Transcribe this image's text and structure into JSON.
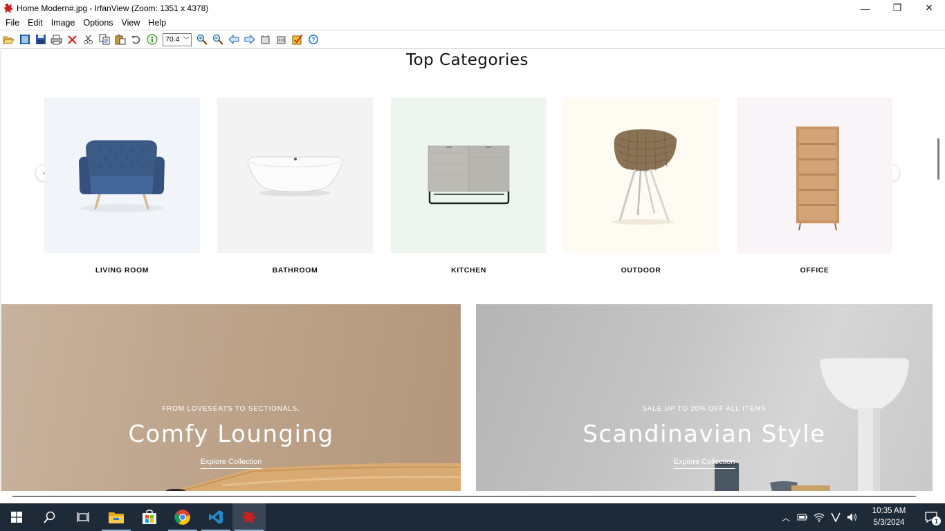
{
  "window": {
    "title": "Home Modern#.jpg - IrfanView (Zoom: 1351 x 4378)",
    "minimize_glyph": "—",
    "maximize_glyph": "❐",
    "close_glyph": "✕"
  },
  "menu": [
    "File",
    "Edit",
    "Image",
    "Options",
    "View",
    "Help"
  ],
  "toolbar": {
    "zoom_value": "70.4",
    "icons": [
      "open-icon",
      "thumbnails-icon",
      "save-icon",
      "print-icon",
      "delete-icon",
      "cut-icon",
      "copy-icon",
      "paste-icon",
      "undo-icon",
      "info-icon",
      "zoom-in-icon",
      "zoom-out-icon",
      "previous-icon",
      "next-icon",
      "first-icon",
      "last-icon",
      "paint-icon",
      "help-icon"
    ]
  },
  "page": {
    "section_title": "Top Categories",
    "categories": [
      {
        "label": "LIVING ROOM",
        "bg": "#f1f5fa"
      },
      {
        "label": "BATHROOM",
        "bg": "#f3f3f3"
      },
      {
        "label": "KITCHEN",
        "bg": "#ecf6ef"
      },
      {
        "label": "OUTDOOR",
        "bg": "#fefbf3"
      },
      {
        "label": "OFFICE",
        "bg": "#f8f4f8"
      }
    ],
    "prev_glyph": "‹",
    "next_glyph": "›",
    "banners": [
      {
        "subtitle": "FROM LOVESEATS TO SECTIONALS.",
        "title": "Comfy Lounging",
        "link": "Explore Collection"
      },
      {
        "subtitle": "SALE UP TO 20% OFF ALL ITEMS",
        "title": "Scandinavian Style",
        "link": "Explore Collection"
      }
    ]
  },
  "taskbar": {
    "time": "10:35 AM",
    "date": "5/3/2024",
    "notification_count": "1",
    "apps": [
      "start-icon",
      "search-icon",
      "task-view-icon",
      "file-explorer-icon",
      "store-icon",
      "chrome-icon",
      "vscode-icon",
      "irfanview-icon"
    ]
  }
}
